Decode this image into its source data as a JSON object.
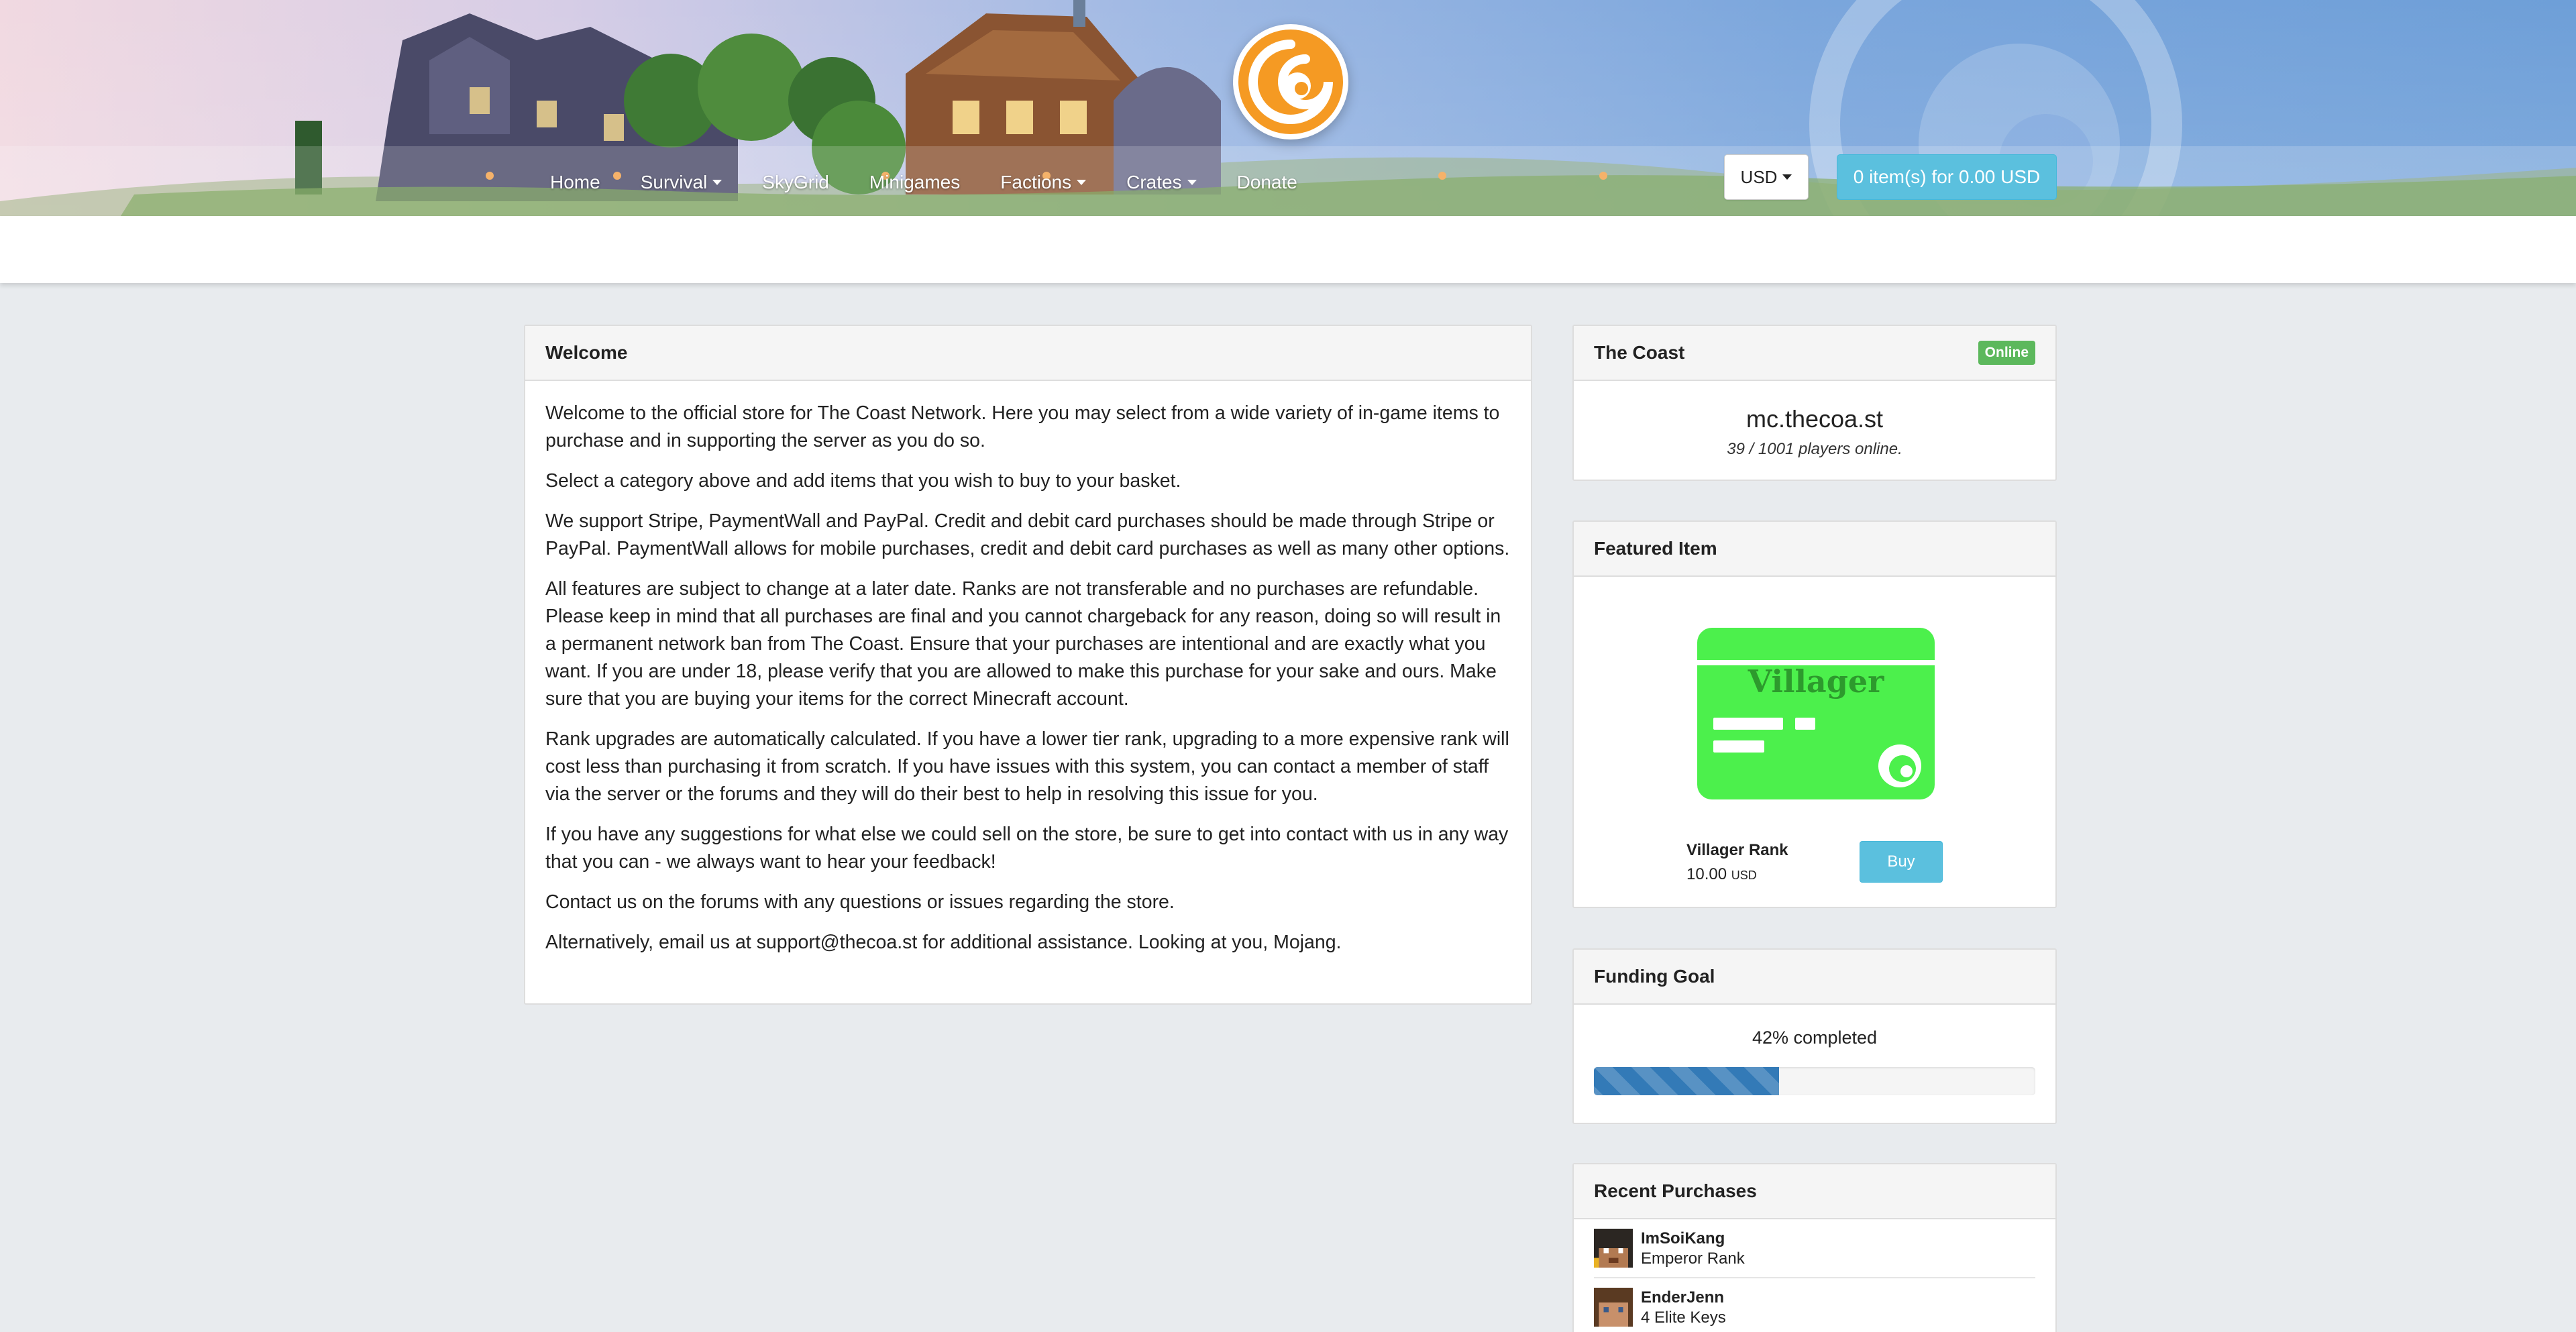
{
  "header": {
    "nav": [
      {
        "label": "Home",
        "dropdown": false
      },
      {
        "label": "Survival",
        "dropdown": true
      },
      {
        "label": "SkyGrid",
        "dropdown": false
      },
      {
        "label": "Minigames",
        "dropdown": false
      },
      {
        "label": "Factions",
        "dropdown": true
      },
      {
        "label": "Crates",
        "dropdown": true
      },
      {
        "label": "Donate",
        "dropdown": false
      }
    ],
    "currency": "USD",
    "basket": "0 item(s) for 0.00 USD"
  },
  "welcome": {
    "title": "Welcome",
    "paragraphs": [
      "Welcome to the official store for The Coast Network. Here you may select from a wide variety of in-game items to purchase and in supporting the server as you do so.",
      "Select a category above and add items that you wish to buy to your basket.",
      "We support Stripe, PaymentWall and PayPal. Credit and debit card purchases should be made through Stripe or PayPal. PaymentWall allows for mobile purchases, credit and debit card purchases as well as many other options.",
      "All features are subject to change at a later date. Ranks are not transferable and no purchases are refundable. Please keep in mind that all purchases are final and you cannot chargeback for any reason, doing so will result in a permanent network ban from The Coast. Ensure that your purchases are intentional and are exactly what you want. If you are under 18, please verify that you are allowed to make this purchase for your sake and ours. Make sure that you are buying your items for the correct Minecraft account.",
      "Rank upgrades are automatically calculated. If you have a lower tier rank, upgrading to a more expensive rank will cost less than purchasing it from scratch. If you have issues with this system, you can contact a member of staff via the server or the forums and they will do their best to help in resolving this issue for you.",
      "If you have any suggestions for what else we could sell on the store, be sure to get into contact with us in any way that you can - we always want to hear your feedback!",
      "Contact us on the forums with any questions or issues regarding the store.",
      "Alternatively, email us at support@thecoa.st for additional assistance. Looking at you, Mojang."
    ]
  },
  "server": {
    "title": "The Coast",
    "status": "Online",
    "ip": "mc.thecoa.st",
    "players": "39 / 1001 players online."
  },
  "featured": {
    "title": "Featured Item",
    "card_text": "Villager",
    "name": "Villager Rank",
    "price": "10.00",
    "currency": "USD",
    "buy_label": "Buy"
  },
  "funding": {
    "title": "Funding Goal",
    "text": "42% completed",
    "progress_fraction": 0.42
  },
  "recent": {
    "title": "Recent Purchases",
    "items": [
      {
        "name": "ImSoiKang",
        "item": "Emperor Rank"
      },
      {
        "name": "EnderJenn",
        "item": "4 Elite Keys"
      }
    ]
  },
  "colors": {
    "accent_info": "#5bc0de",
    "online_badge": "#5cb85c",
    "progress": "#337ab7",
    "rank_card": "#4cf04c"
  }
}
